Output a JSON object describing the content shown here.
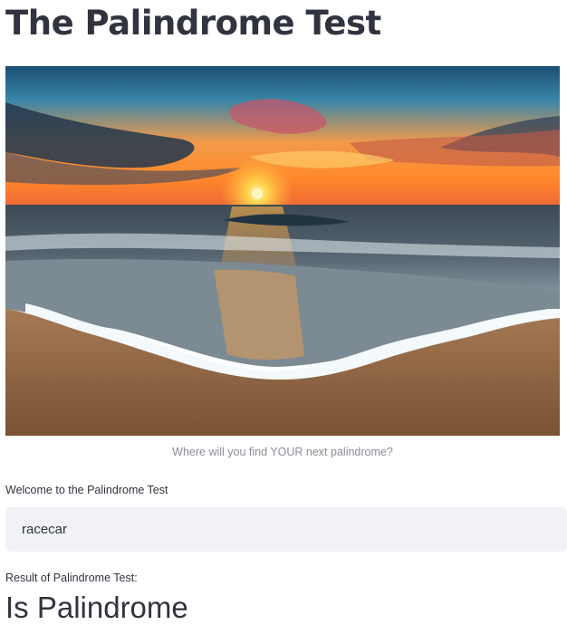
{
  "header": {
    "title": "The Palindrome Test"
  },
  "hero": {
    "image": "sunset-beach-wave-photo",
    "caption": "Where will you find YOUR next palindrome?"
  },
  "form": {
    "input_label": "Welcome to the Palindrome Test",
    "input_value": "racecar"
  },
  "result": {
    "label": "Result of Palindrome Test:",
    "value": "Is Palindrome"
  },
  "colors": {
    "text": "#31333f",
    "caption": "#8b8d96",
    "input_bg": "#f0f2f6"
  }
}
